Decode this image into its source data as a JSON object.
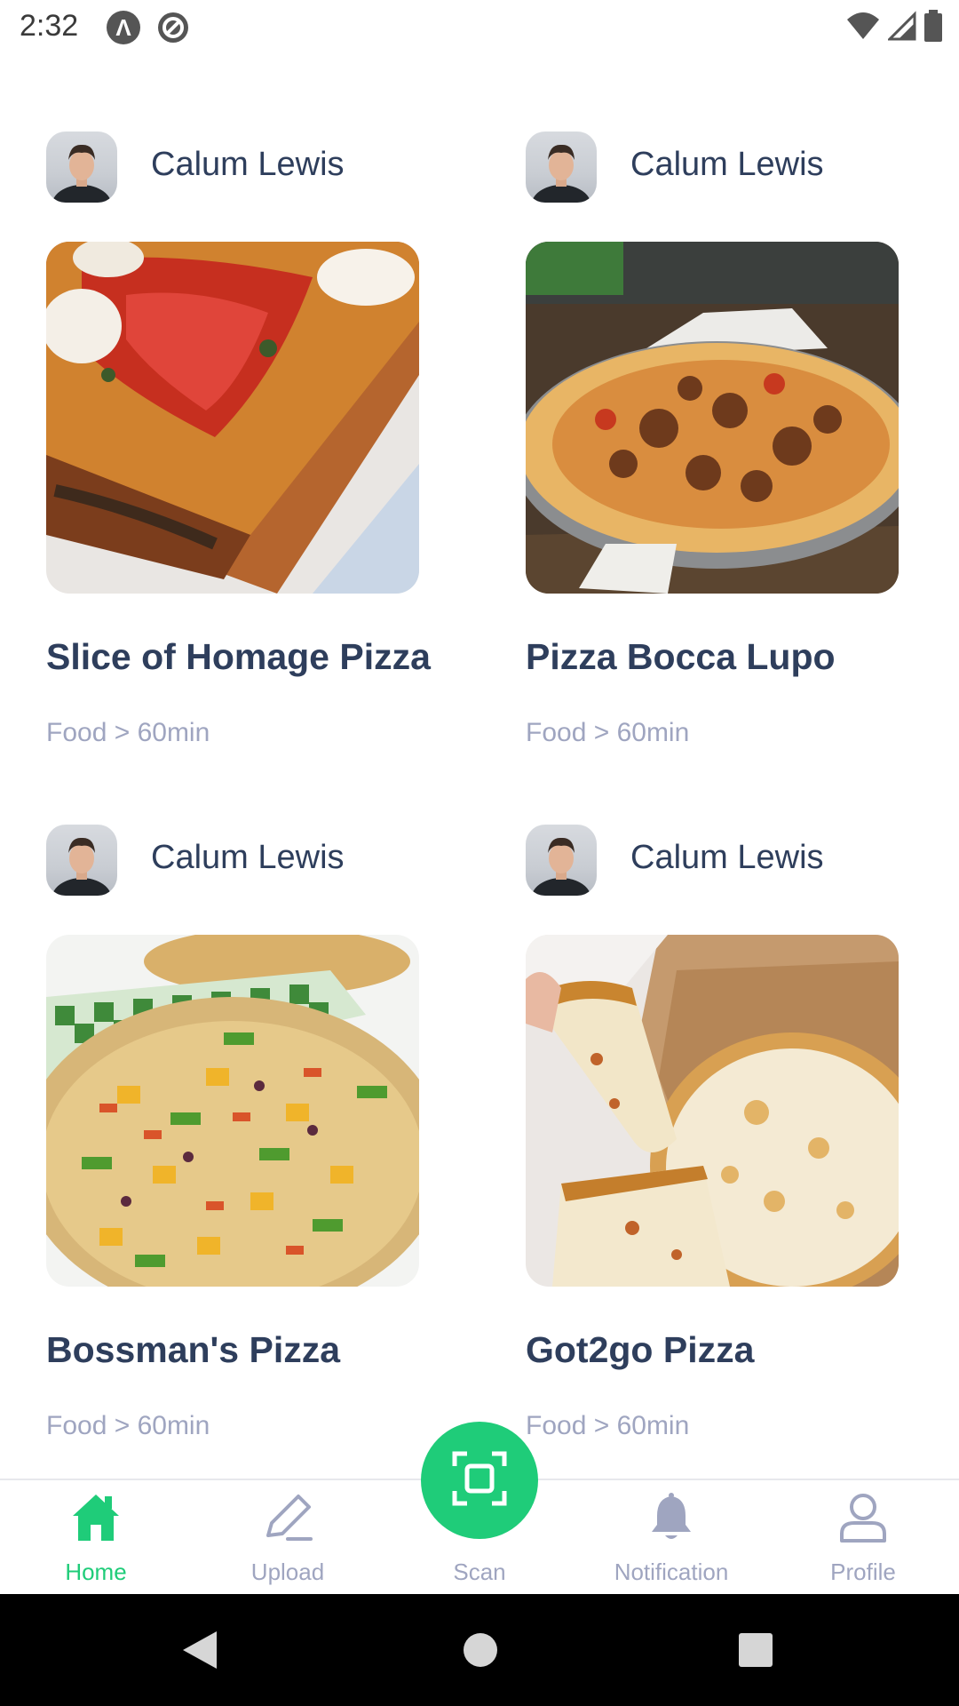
{
  "status_bar": {
    "time": "2:32",
    "icons": [
      "app-a-icon",
      "app-at-icon",
      "wifi-icon",
      "cell-signal-icon",
      "battery-icon"
    ]
  },
  "cutoff_meta": [
    "Food > 60min",
    "Food > 60min"
  ],
  "cards": [
    {
      "author": "Calum Lewis",
      "title": "Slice of Homage Pizza",
      "meta": "Food > 60min"
    },
    {
      "author": "Calum Lewis",
      "title": "Pizza Bocca Lupo",
      "meta": "Food > 60min"
    },
    {
      "author": "Calum Lewis",
      "title": "Bossman's Pizza",
      "meta": "Food > 60min"
    },
    {
      "author": "Calum Lewis",
      "title": "Got2go Pizza",
      "meta": "Food > 60min"
    }
  ],
  "bottom_nav": {
    "items": [
      {
        "label": "Home",
        "icon": "home-icon",
        "active": true
      },
      {
        "label": "Upload",
        "icon": "pencil-icon",
        "active": false
      },
      {
        "label": "Scan",
        "icon": "scan-icon",
        "active": false
      },
      {
        "label": "Notification",
        "icon": "bell-icon",
        "active": false
      },
      {
        "label": "Profile",
        "icon": "user-icon",
        "active": false
      }
    ]
  },
  "colors": {
    "accent": "#1FCC79",
    "title": "#2E3E5C",
    "secondary": "#9FA5C0"
  }
}
